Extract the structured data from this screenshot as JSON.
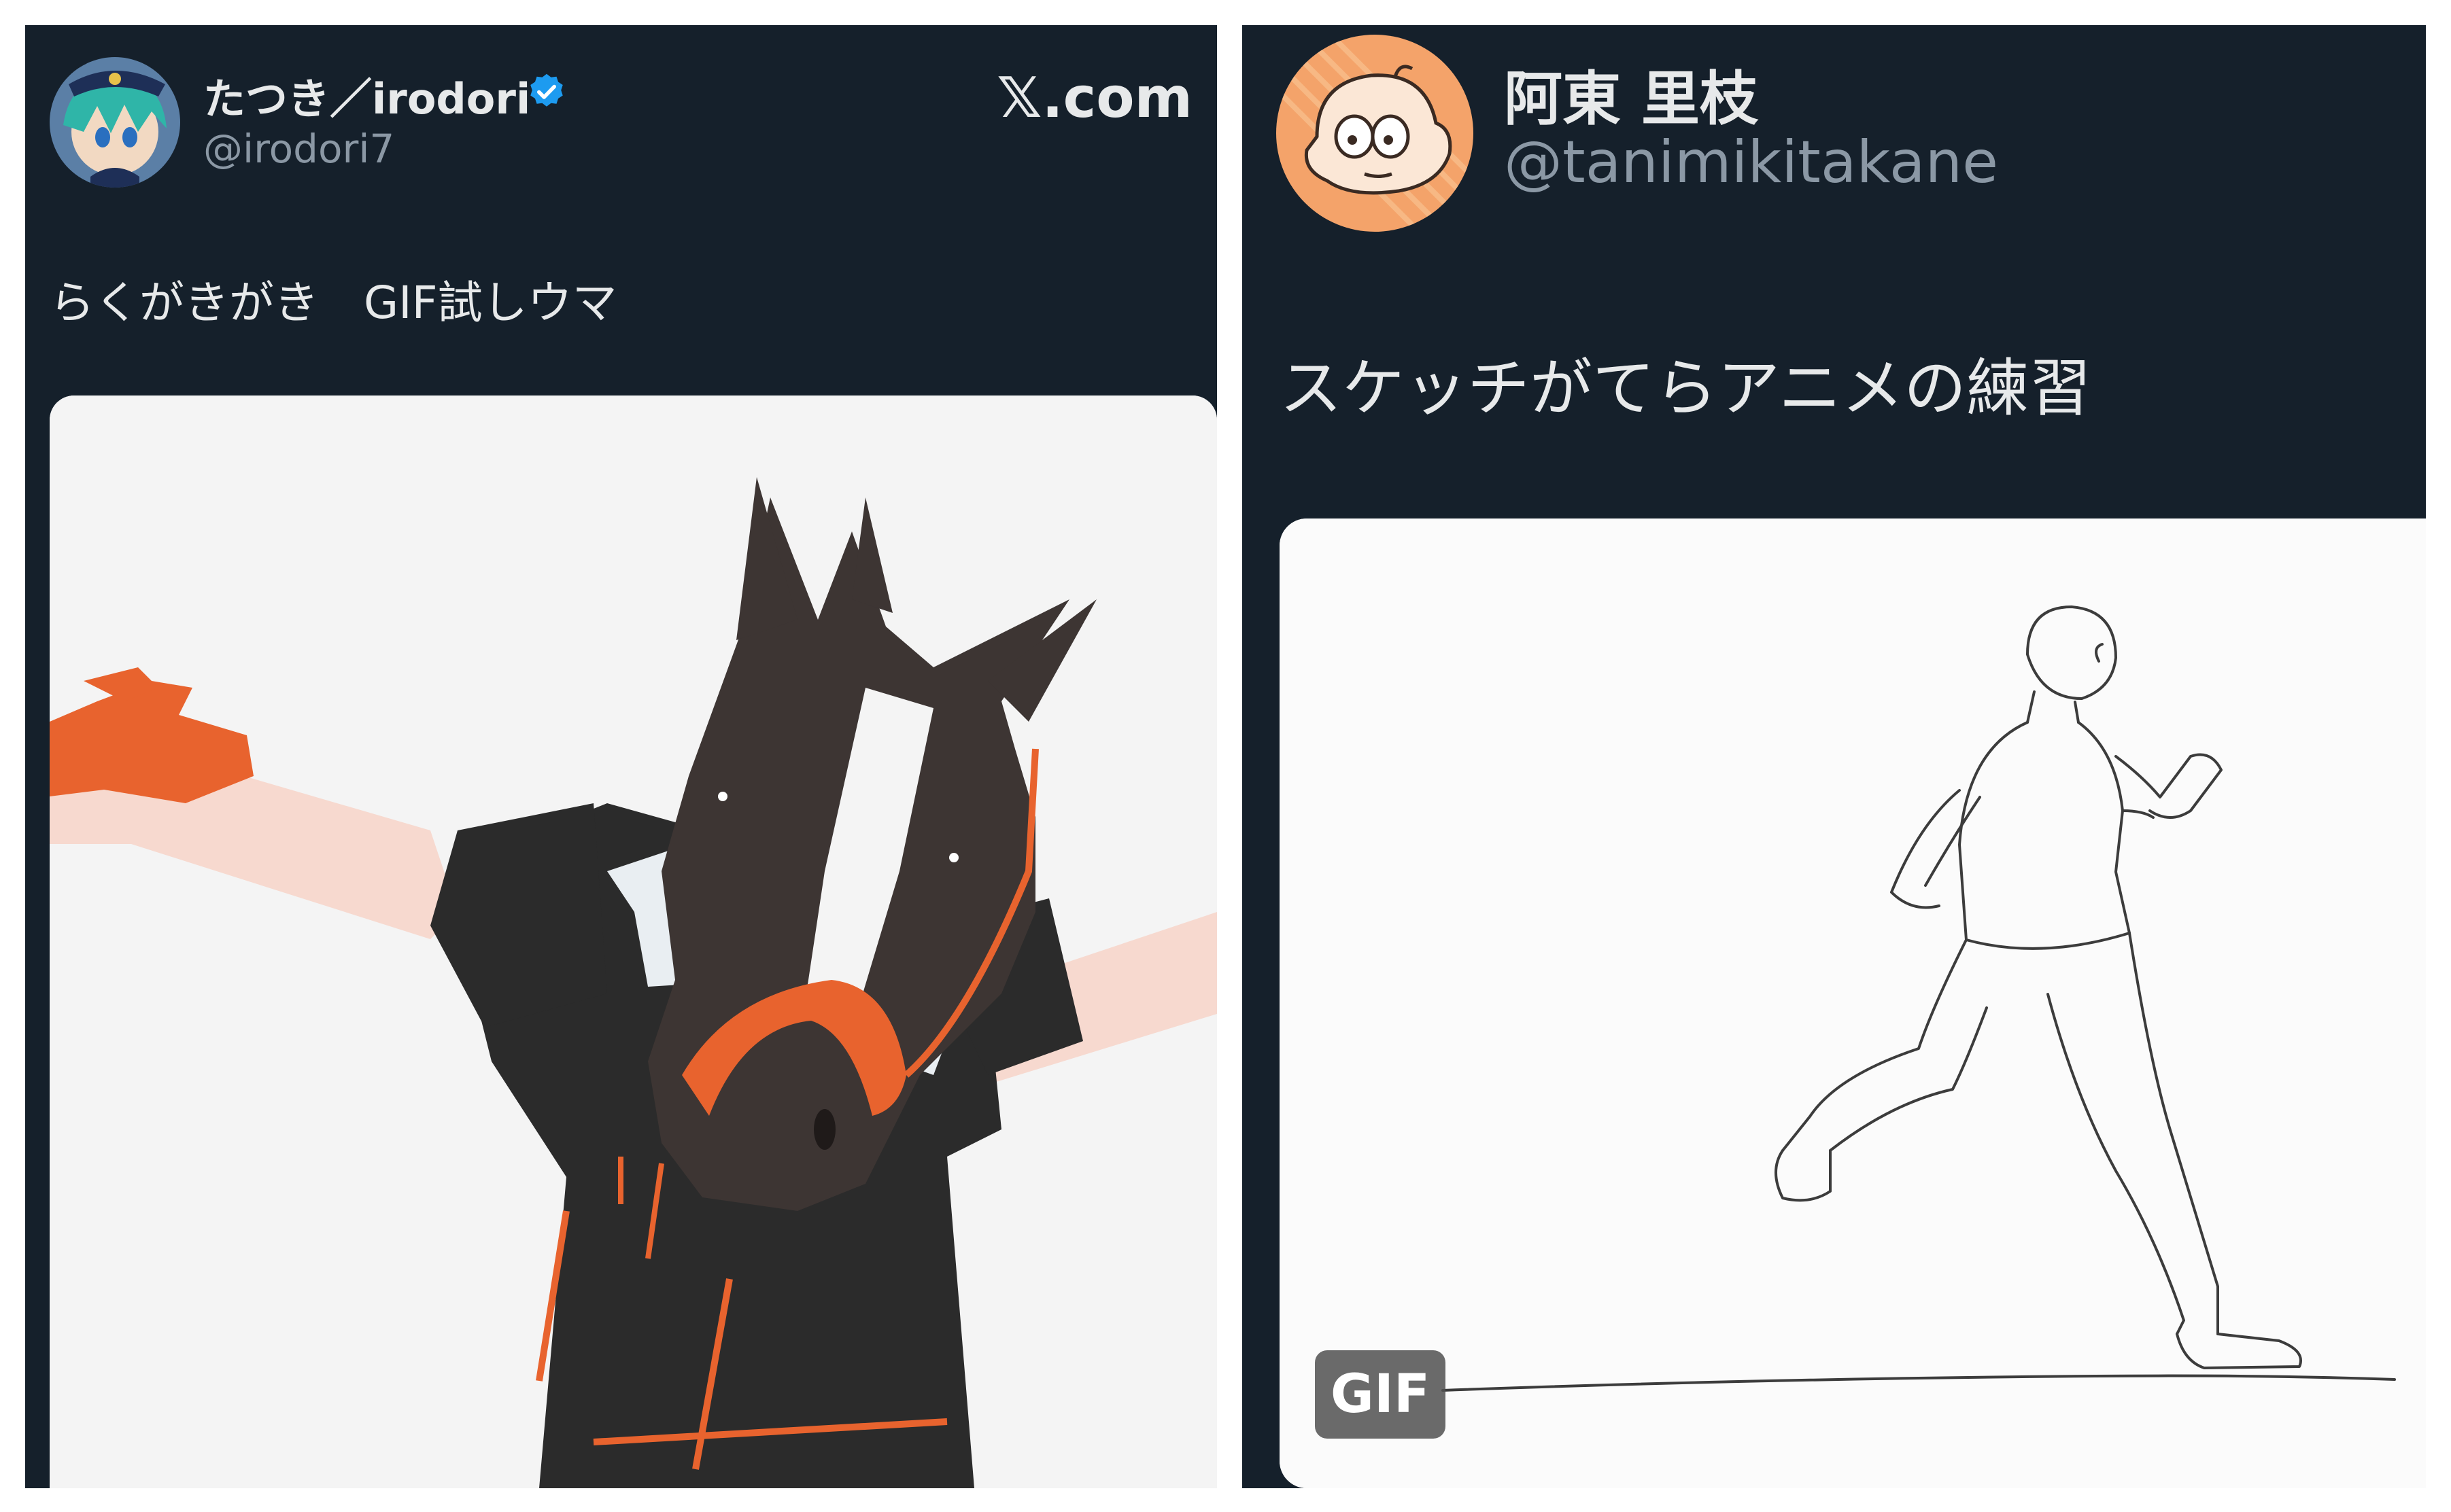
{
  "left_post": {
    "display_name": "たつき／irodori",
    "verified_icon": "verified-badge-icon",
    "handle": "@irodori7",
    "site": "𝕏.com",
    "text": "らくがきがき　GIF試しウマ",
    "media": "illustration of a horse-headed figure in black and orange outfit with arms outstretched"
  },
  "right_post": {
    "display_name": "阿東 里枝",
    "handle": "@tanimikitakane",
    "text": "スケッチがてらアニメの練習",
    "media": "line sketch animation of a running man",
    "gif_badge": "GIF"
  },
  "colors": {
    "background": "#15202b",
    "primary_text": "#e7e9ea",
    "secondary_text": "#8b98a5",
    "verified": "#1d9bf0",
    "accent_orange": "#e8632e"
  }
}
